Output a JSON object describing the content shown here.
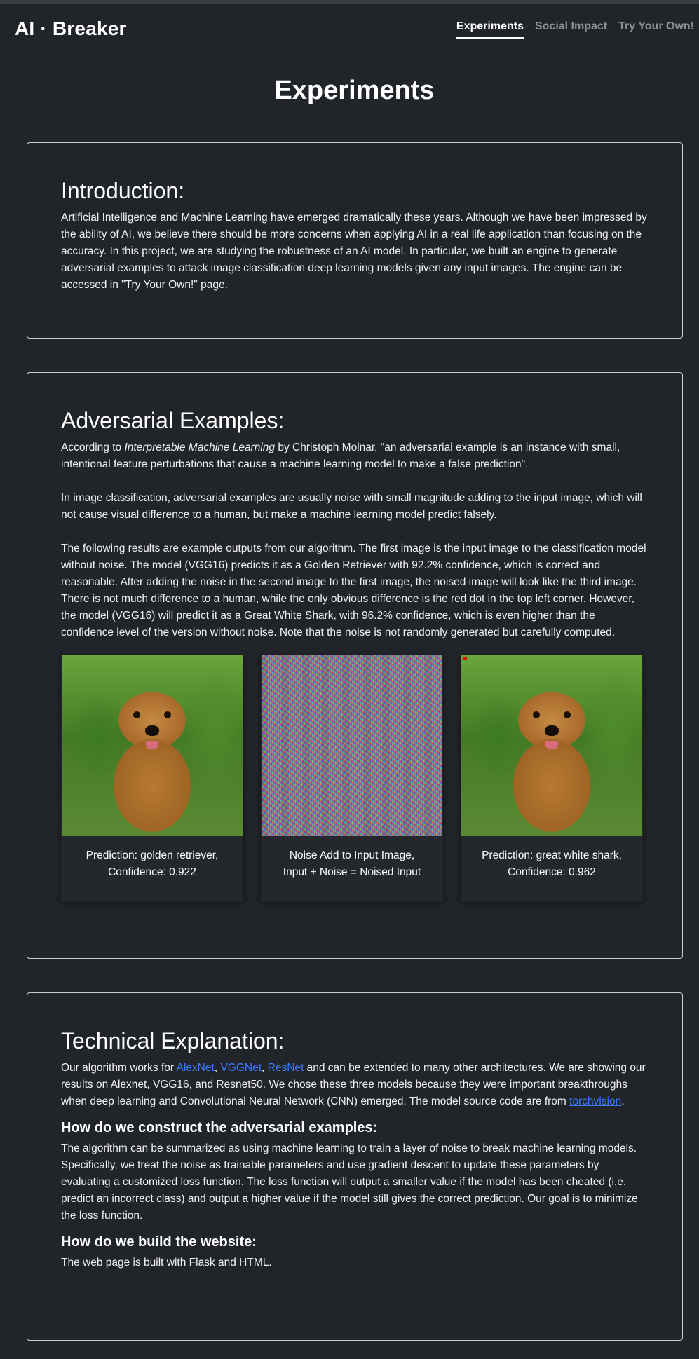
{
  "nav": {
    "brand": "AI · Breaker",
    "links": [
      "Experiments",
      "Social Impact",
      "Try Your Own!"
    ],
    "active": "Experiments"
  },
  "page": {
    "title": "Experiments"
  },
  "intro": {
    "heading": "Introduction:",
    "text": "Artificial Intelligence and Machine Learning have emerged dramatically these years. Although we have been impressed by the ability of AI, we believe there should be more concerns when applying AI in a real life application than focusing on the accuracy. In this project, we are studying the robustness of an AI model. In particular, we built an engine to generate adversarial examples to attack image classification deep learning models given any input images. The engine can be accessed in \"Try Your Own!\" page."
  },
  "adversarial": {
    "heading": "Adversarial Examples:",
    "p1_before": "According to ",
    "p1_italic": "Interpretable Machine Learning",
    "p1_after": " by Christoph Molnar, \"an adversarial example is an instance with small, intentional feature perturbations that cause a machine learning model to make a false prediction\".",
    "p2": "In image classification, adversarial examples are usually noise with small magnitude adding to the input image, which will not cause visual difference to a human, but make a machine learning model predict falsely.",
    "p3": "The following results are example outputs from our algorithm. The first image is the input image to the classification model without noise. The model (VGG16) predicts it as a Golden Retriever with 92.2% confidence, which is correct and reasonable. After adding the noise in the second image to the first image, the noised image will look like the third image. There is not much difference to a human, while the only obvious difference is the red dot in the top left corner. However, the model (VGG16) will predict it as a Great White Shark, with 96.2% confidence, which is even higher than the confidence level of the version without noise. Note that the noise is not randomly generated but carefully computed.",
    "images": [
      {
        "caption_line1": "Prediction: golden retriever,",
        "caption_line2": "Confidence: 0.922"
      },
      {
        "caption_line1": "Noise Add to Input Image,",
        "caption_line2": "Input + Noise = Noised Input"
      },
      {
        "caption_line1": "Prediction: great white shark,",
        "caption_line2": "Confidence: 0.962"
      }
    ]
  },
  "technical": {
    "heading": "Technical Explanation:",
    "p1_start": "Our algorithm works for ",
    "link_alexnet": "AlexNet",
    "sep1": ", ",
    "link_vggnet": "VGGNet",
    "sep2": ", ",
    "link_resnet": "ResNet",
    "p1_mid": " and can be extended to many other architectures. We are showing our results on Alexnet, VGG16, and Resnet50. We chose these three models because they were important breakthroughs when deep learning and Convolutional Neural Network (CNN) emerged. The model source code are from ",
    "link_torchvision": "torchvision",
    "p1_end": ".",
    "sub1": "How do we construct the adversarial examples:",
    "p2": "The algorithm can be summarized as using machine learning to train a layer of noise to break machine learning models. Specifically, we treat the noise as trainable parameters and use gradient descent to update these parameters by evaluating a customized loss function. The loss function will output a smaller value if the model has been cheated (i.e. predict an incorrect class) and output a higher value if the model still gives the correct prediction. Our goal is to minimize the loss function.",
    "sub2": "How do we build the website:",
    "p3": "The web page is built with Flask and HTML."
  }
}
